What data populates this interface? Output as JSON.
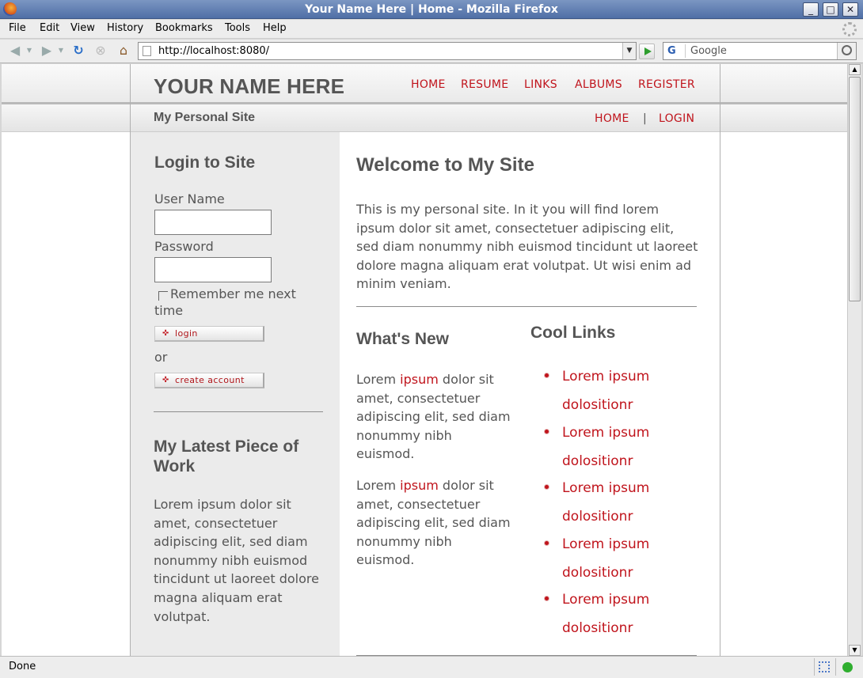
{
  "window": {
    "title": "Your Name Here | Home - Mozilla Firefox",
    "controls": [
      "_",
      "□",
      "✕"
    ]
  },
  "menu": [
    "File",
    "Edit",
    "View",
    "History",
    "Bookmarks",
    "Tools",
    "Help"
  ],
  "toolbar": {
    "url": "http://localhost:8080/",
    "search_placeholder": "Google",
    "search_engine": "G"
  },
  "status": {
    "text": "Done"
  },
  "site": {
    "logo": "YOUR NAME HERE",
    "top_nav": [
      "HOME",
      "RESUME",
      "LINKS",
      "ALBUMS",
      "REGISTER"
    ],
    "tagline": "My Personal Site",
    "sub_nav": {
      "home": "HOME",
      "separator": "|",
      "login": "LOGIN"
    }
  },
  "login": {
    "heading": "Login to Site",
    "username_label": "User Name",
    "password_label": "Password",
    "remember_line1": "Remember me next",
    "remember_line2": "time",
    "login_button": "login",
    "or": "or",
    "create_button": "create account"
  },
  "latest": {
    "heading_line1": "My Latest Piece of",
    "heading_line2": "Work",
    "text": "Lorem ipsum dolor sit amet, consectetuer adipiscing elit, sed diam nonummy nibh euismod tincidunt ut laoreet dolore magna aliquam erat volutpat."
  },
  "welcome": {
    "heading": "Welcome to My Site",
    "text": "This is my personal site. In it you will find lorem ipsum dolor sit amet, consectetuer adipiscing elit, sed diam nonummy nibh euismod tincidunt ut laoreet dolore magna aliquam erat volutpat. Ut wisi enim ad minim veniam."
  },
  "whats_new": {
    "heading": "What's New",
    "items": [
      {
        "pre": "Lorem ",
        "link": "ipsum",
        "post": " dolor sit amet, consectetuer adipiscing elit, sed diam nonummy nibh euismod."
      },
      {
        "pre": "Lorem ",
        "link": "ipsum",
        "post": " dolor sit amet, consectetuer adipiscing elit, sed diam nonummy nibh euismod."
      }
    ]
  },
  "cool_links": {
    "heading": "Cool Links",
    "links": [
      {
        "line1": "Lorem ipsum",
        "line2": "dolositionr"
      },
      {
        "line1": "Lorem ipsum",
        "line2": "dolositionr"
      },
      {
        "line1": "Lorem ipsum",
        "line2": "dolositionr"
      },
      {
        "line1": "Lorem ipsum",
        "line2": "dolositionr"
      },
      {
        "line1": "Lorem ipsum",
        "line2": "dolositionr"
      }
    ]
  }
}
